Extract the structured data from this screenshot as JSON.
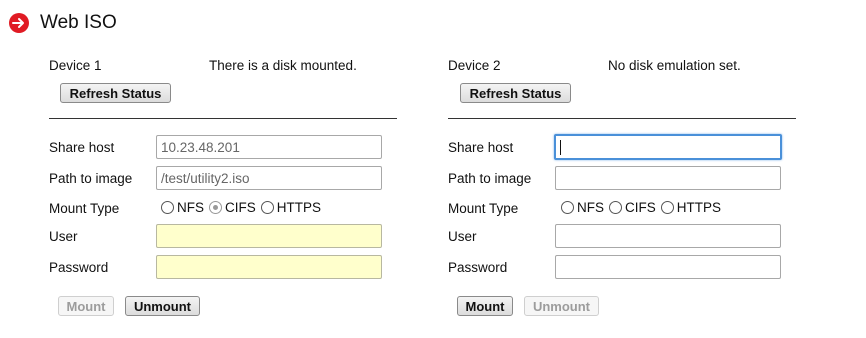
{
  "header": {
    "title": "Web ISO"
  },
  "devices": [
    {
      "name": "Device 1",
      "status": "There is a disk mounted.",
      "refresh_label": "Refresh Status",
      "labels": {
        "share_host": "Share host",
        "path": "Path to image",
        "mount_type": "Mount Type",
        "user": "User",
        "password": "Password"
      },
      "share_host": "10.23.48.201",
      "path": "/test/utility2.iso",
      "user": "",
      "password": "",
      "mount_options": [
        "NFS",
        "CIFS",
        "HTTPS"
      ],
      "selected_mount": "CIFS",
      "mount_label": "Mount",
      "unmount_label": "Unmount"
    },
    {
      "name": "Device 2",
      "status": "No disk emulation set.",
      "refresh_label": "Refresh Status",
      "labels": {
        "share_host": "Share host",
        "path": "Path to image",
        "mount_type": "Mount Type",
        "user": "User",
        "password": "Password"
      },
      "share_host": "",
      "path": "",
      "user": "",
      "password": "",
      "mount_options": [
        "NFS",
        "CIFS",
        "HTTPS"
      ],
      "selected_mount": "",
      "mount_label": "Mount",
      "unmount_label": "Unmount"
    }
  ]
}
